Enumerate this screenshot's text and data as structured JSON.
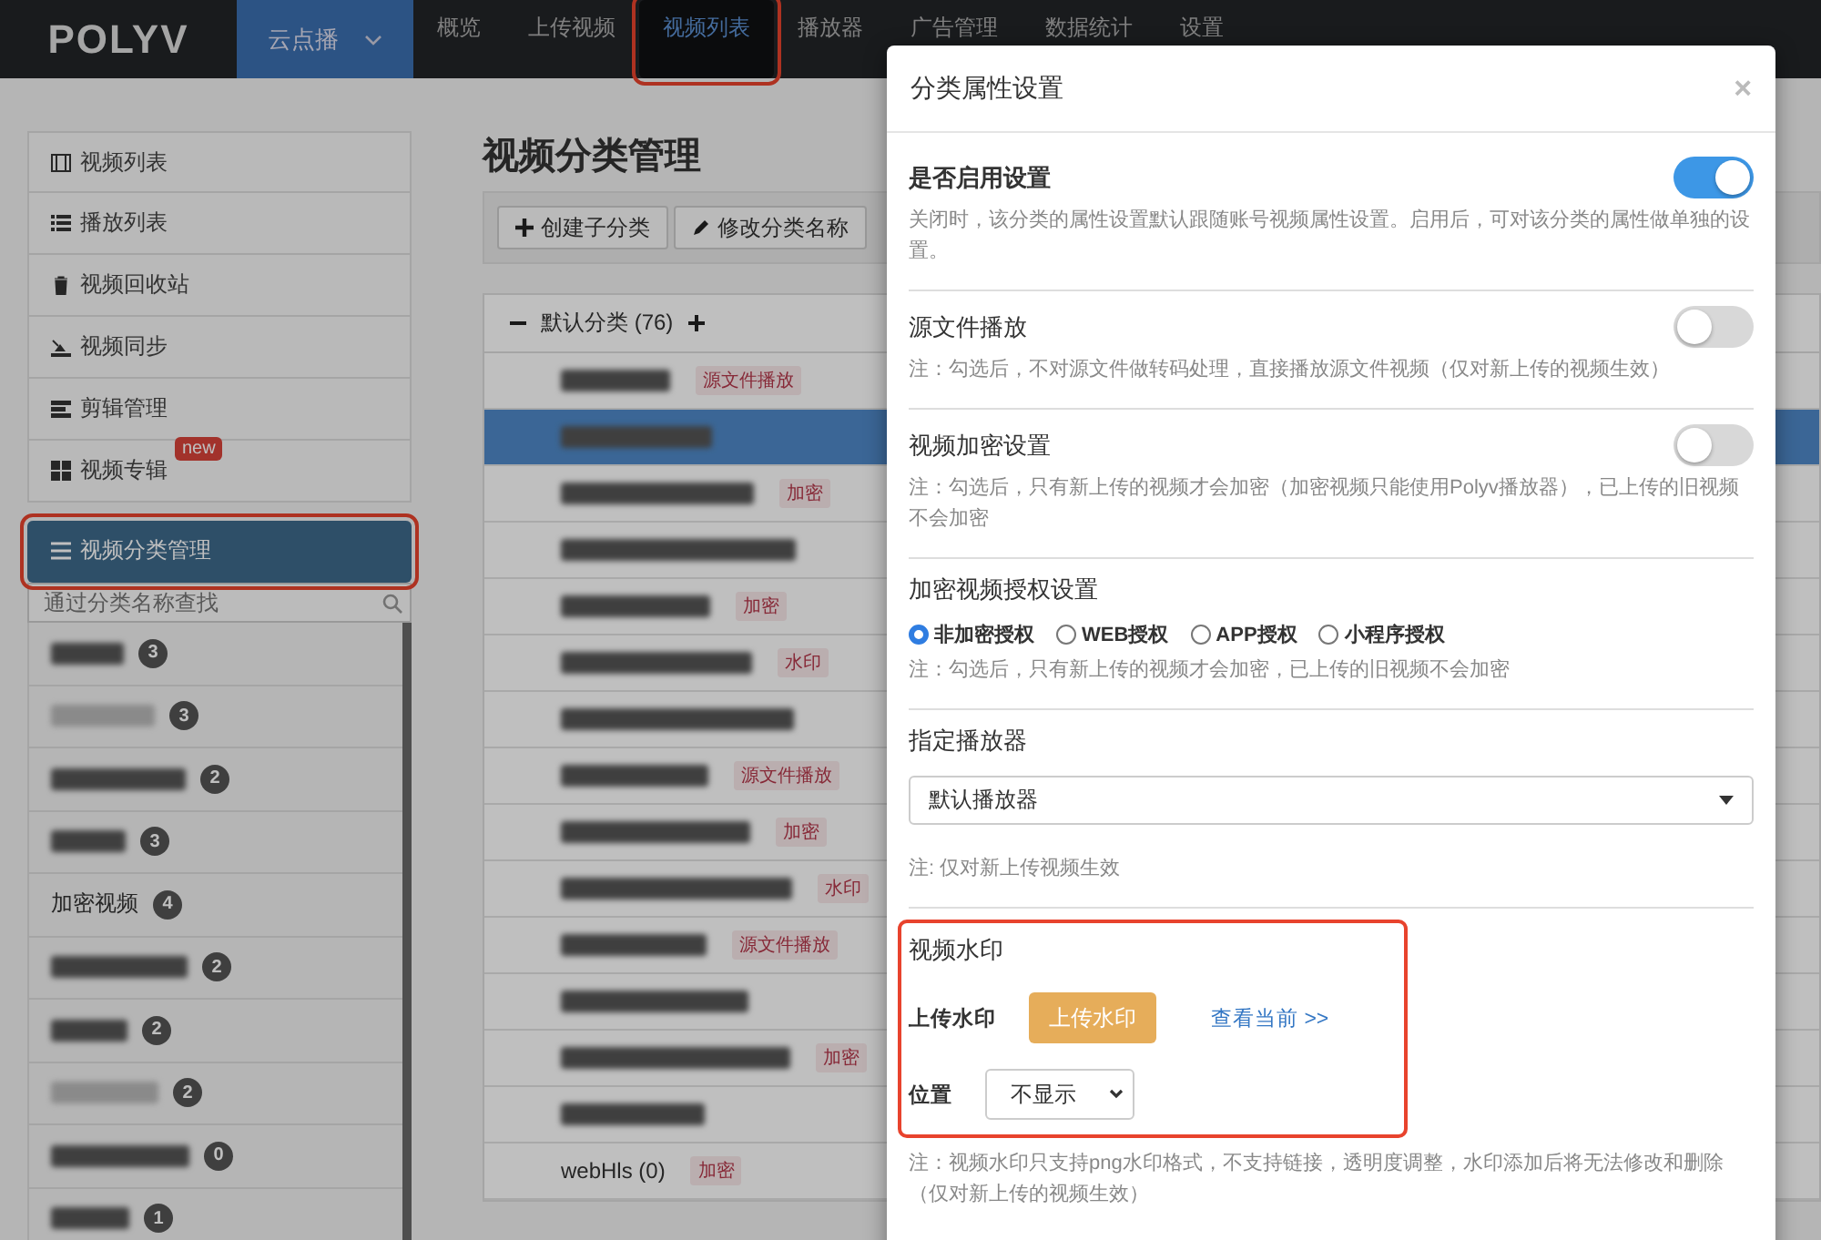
{
  "nav": {
    "logo": "POLYV",
    "product": "云点播",
    "items": [
      {
        "label": "概览",
        "selected": false,
        "highlighted": false
      },
      {
        "label": "上传视频",
        "selected": false,
        "highlighted": false
      },
      {
        "label": "视频列表",
        "selected": true,
        "highlighted": true
      },
      {
        "label": "播放器",
        "selected": false,
        "highlighted": false
      },
      {
        "label": "广告管理",
        "selected": false,
        "highlighted": false
      },
      {
        "label": "数据统计",
        "selected": false,
        "highlighted": false
      },
      {
        "label": "设置",
        "selected": false,
        "highlighted": false
      }
    ]
  },
  "sidebar": {
    "items": [
      {
        "label": "视频列表",
        "selected": false,
        "highlighted": false
      },
      {
        "label": "播放列表",
        "selected": false,
        "highlighted": false
      },
      {
        "label": "视频回收站",
        "selected": false,
        "highlighted": false
      },
      {
        "label": "视频同步",
        "selected": false,
        "highlighted": false
      },
      {
        "label": "剪辑管理",
        "selected": false,
        "highlighted": false
      },
      {
        "label": "视频专辑",
        "selected": false,
        "highlighted": false,
        "badge": "new"
      },
      {
        "label": "视频分类管理",
        "selected": true,
        "highlighted": true
      }
    ],
    "search": {
      "placeholder": "通过分类名称查找"
    },
    "categories": [
      {
        "count": "3"
      },
      {
        "count": "3"
      },
      {
        "count": "2"
      },
      {
        "count": "3"
      },
      {
        "label": "加密视频",
        "count": "4"
      },
      {
        "count": "2"
      },
      {
        "count": "2"
      },
      {
        "count": "2"
      },
      {
        "count": "0"
      },
      {
        "count": "1"
      }
    ]
  },
  "main": {
    "title": "视频分类管理",
    "toolbar": [
      "创建子分类",
      "修改分类名称"
    ],
    "tree": {
      "label": "默认分类 (76)",
      "expanded": true,
      "rows": [
        {
          "tag": "源文件播放",
          "selected": false
        },
        {
          "selected": true
        },
        {
          "tag": "加密",
          "selected": false
        },
        {
          "selected": false
        },
        {
          "tag": "加密",
          "selected": false
        },
        {
          "tag": "水印",
          "selected": false
        },
        {
          "selected": false
        },
        {
          "tag": "源文件播放",
          "selected": false
        },
        {
          "tag": "加密",
          "selected": false
        },
        {
          "tag": "水印",
          "selected": false
        },
        {
          "tag": "源文件播放",
          "selected": false
        },
        {
          "selected": false
        },
        {
          "tag": "加密",
          "selected": false
        },
        {
          "selected": false
        },
        {
          "label": "webHls (0)",
          "tag": "加密",
          "selected": false
        }
      ]
    }
  },
  "modal": {
    "title": "分类属性设置",
    "close": "×",
    "sections": [
      {
        "kind": "toggle",
        "title": "是否启用设置",
        "bold": true,
        "on": true,
        "note": "关闭时，该分类的属性设置默认跟随账号视频属性设置。启用后，可对该分类的属性做单独的设置。"
      },
      {
        "kind": "toggle",
        "title": "源文件播放",
        "bold": false,
        "on": false,
        "note": "注：勾选后，不对源文件做转码处理，直接播放源文件视频（仅对新上传的视频生效）"
      },
      {
        "kind": "toggle",
        "title": "视频加密设置",
        "bold": false,
        "on": false,
        "note": "注：勾选后，只有新上传的视频才会加密（加密视频只能使用Polyv播放器），已上传的旧视频不会加密"
      },
      {
        "kind": "radio",
        "title": "加密视频授权设置",
        "options": [
          {
            "label": "非加密授权",
            "selected": true
          },
          {
            "label": "WEB授权",
            "selected": false
          },
          {
            "label": "APP授权",
            "selected": false
          },
          {
            "label": "小程序授权",
            "selected": false
          }
        ],
        "note": "注：勾选后，只有新上传的视频才会加密，已上传的旧视频不会加密"
      },
      {
        "kind": "select",
        "title": "指定播放器",
        "value": "默认播放器",
        "note": "注: 仅对新上传视频生效"
      },
      {
        "kind": "watermark",
        "title": "视频水印",
        "highlighted": true,
        "upload_label": "上传水印",
        "upload_button": "上传水印",
        "link": "查看当前 >>",
        "position_label": "位置",
        "position_value": "不显示",
        "note": "注：视频水印只支持png水印格式，不支持链接，透明度调整，水印添加后将无法修改和删除（仅对新上传的视频生效）"
      }
    ]
  }
}
